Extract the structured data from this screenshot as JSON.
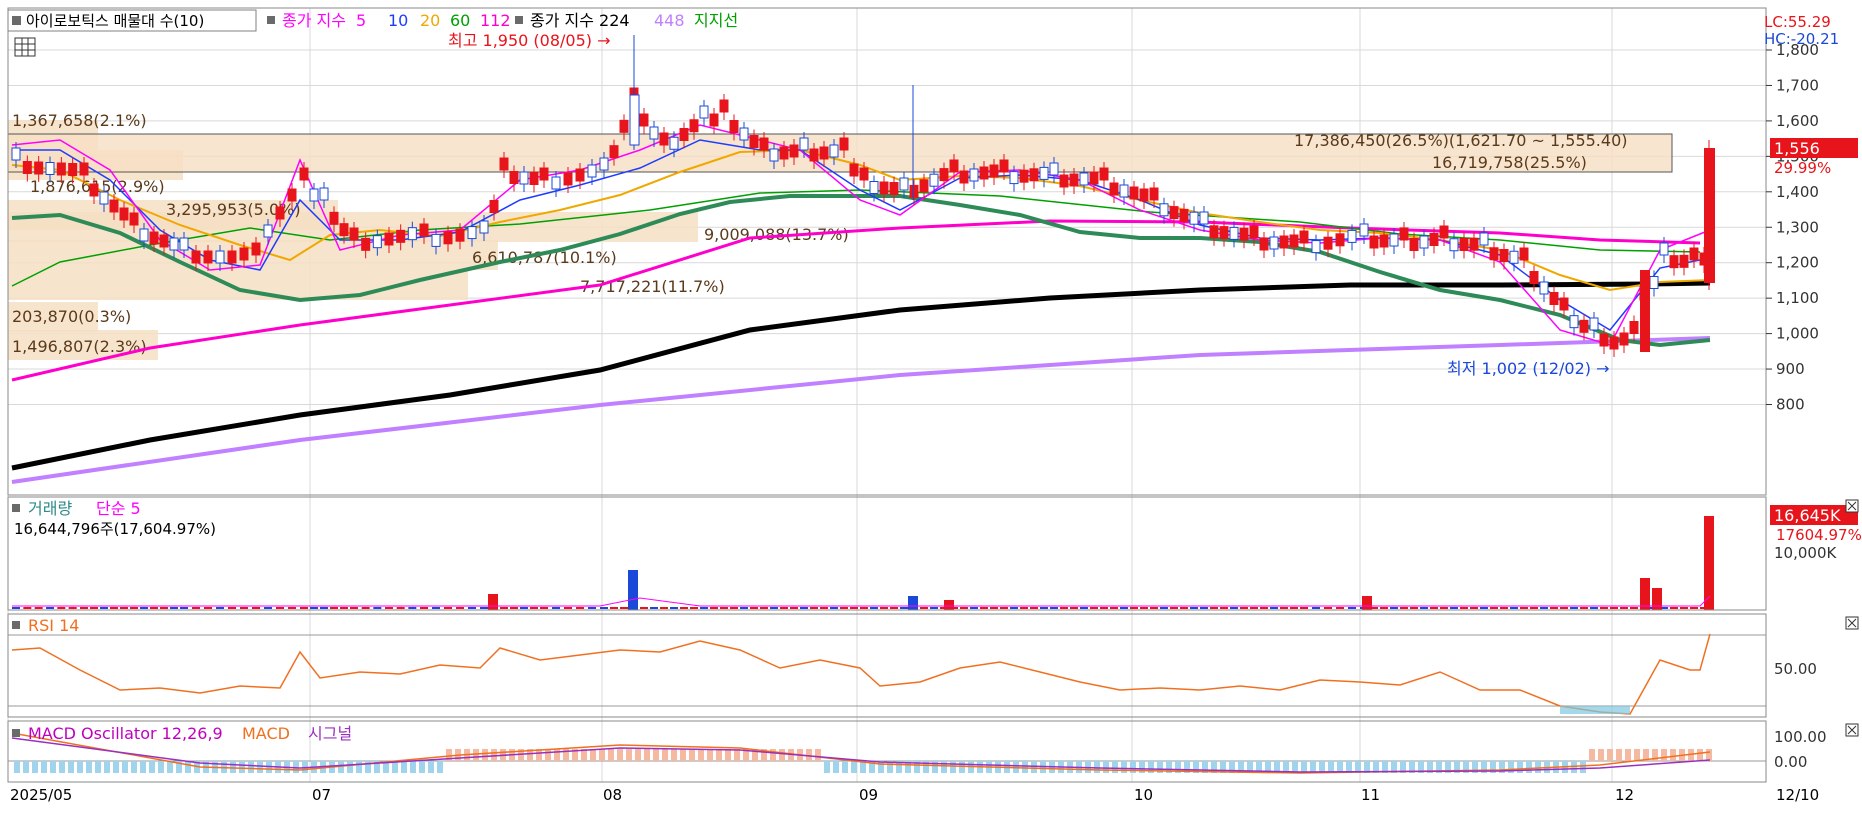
{
  "header": {
    "title_box": "아이로보틱스 매물대 수(10)",
    "ma_label": "종가 지수",
    "ma_periods": [
      "5",
      "10",
      "20",
      "60",
      "112"
    ],
    "ma_colors": [
      "#ff00ff",
      "#1e3cff",
      "#f0a800",
      "#00a000",
      "#ff00cc"
    ],
    "long_ma_label": "종가 지수 224",
    "long_ma_448": "448",
    "support_label": "지지선"
  },
  "price_panel": {
    "lc_label": "LC:55.29",
    "hc_label": "HC:-20.21",
    "high_annotation": "최고 1,950 (08/05) →",
    "low_annotation": "최저 1,002 (12/02) →",
    "current_price": "1,556",
    "current_change": "29.99%",
    "y_ticks": [
      "1,800",
      "1,700",
      "1,600",
      "1,500",
      "1,400",
      "1,300",
      "1,200",
      "1,100",
      "1,000",
      "900",
      "800"
    ],
    "volume_profile_labels": [
      "1,367,658(2.1%)",
      "1,876,615(2.9%)",
      "3,295,953(5.0%)",
      "6,610,787(10.1%)",
      "9,009,088(13.7%)",
      "7,717,221(11.7%)",
      "203,870(0.3%)",
      "1,496,807(2.3%)",
      "17,386,450(26.5%)(1,621.70 ~ 1,555.40)",
      "16,719,758(25.5%)"
    ]
  },
  "volume_panel": {
    "title": "거래량",
    "ma_label": "단순 5",
    "current_volume": "16,644,796주(17,604.97%)",
    "y_tick": "10,000K",
    "current_badge": "16,645K",
    "current_pct": "17604.97%"
  },
  "rsi_panel": {
    "title": "RSI 14",
    "y_tick": "50.00"
  },
  "macd_panel": {
    "title": "MACD Oscillator 12,26,9",
    "macd_label": "MACD",
    "signal_label": "시그널",
    "y_ticks": [
      "100.00",
      "0.00"
    ]
  },
  "x_axis": {
    "labels": [
      "2025/05",
      "07",
      "08",
      "09",
      "10",
      "11",
      "12"
    ],
    "right_label": "12/10"
  },
  "chart_data": {
    "type": "candlestick",
    "y_range": [
      770,
      1960
    ],
    "legend_series": [
      "5",
      "10",
      "20",
      "60",
      "112",
      "224",
      "448"
    ],
    "price_points_approx": [
      {
        "x": "2025/05",
        "close": 1500
      },
      {
        "x": "07",
        "close": 1620
      },
      {
        "x": "08",
        "close": 1510
      },
      {
        "x": "08/05",
        "high": 1950
      },
      {
        "x": "09",
        "close": 1480
      },
      {
        "x": "10",
        "close": 1360
      },
      {
        "x": "11",
        "close": 1300
      },
      {
        "x": "12/02",
        "low": 1002
      },
      {
        "x": "12/10",
        "close": 1556
      }
    ]
  },
  "colors": {
    "up": "#e8141b",
    "down": "#1a48d8",
    "grid": "#d9d9d9",
    "panel_border": "#8a8a8a",
    "badge_red": "#e8141b"
  }
}
